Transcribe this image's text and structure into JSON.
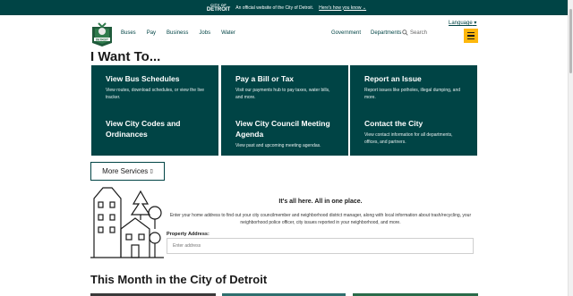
{
  "topbar": {
    "logo_line1": "CITY OF",
    "logo_line2": "DETROIT",
    "official_text": "An official website of the City of Detroit.",
    "how_know": "Here's how you know"
  },
  "header": {
    "language": "Language",
    "nav_left": [
      "Buses",
      "Pay",
      "Business",
      "Jobs",
      "Water"
    ],
    "nav_right": [
      "Government",
      "Departments"
    ],
    "search_placeholder": "Search"
  },
  "iwant": {
    "heading": "I Want To...",
    "tiles": [
      {
        "title": "View Bus Schedules",
        "desc": "View routes, download schedules, or view the live tracker."
      },
      {
        "title": "Pay a Bill or Tax",
        "desc": "Visit our payments hub to pay taxes, water bills, and more."
      },
      {
        "title": "Report an Issue",
        "desc": "Report issues like potholes, illegal dumping, and more."
      },
      {
        "title": "View City Codes and Ordinances",
        "desc": ""
      },
      {
        "title": "View City Council Meeting Agenda",
        "desc": "View past and upcoming meeting agendas."
      },
      {
        "title": "Contact the City",
        "desc": "View contact information for all departments, offices, and partners."
      }
    ],
    "more_services": "More Services"
  },
  "address": {
    "heading": "It's all here. All in one place.",
    "description": "Enter your home address to find out your city councilmember and neighborhood district manager, along with local information about trash/recycling, your neighborhood police officer, city issues reported in your neighborhood, and more.",
    "label": "Property Address:",
    "placeholder": "Enter address"
  },
  "month_heading": "This Month in the City of Detroit",
  "colors": {
    "brand": "#004445",
    "accent": "#feb70d"
  }
}
